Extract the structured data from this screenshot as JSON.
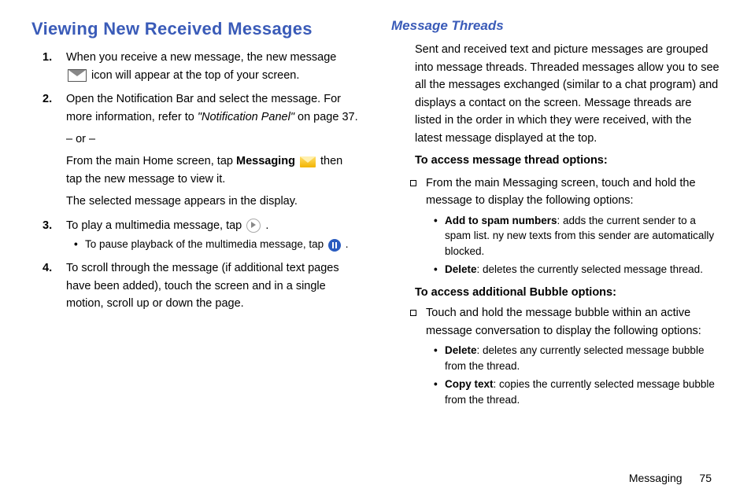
{
  "left": {
    "heading": "Viewing New Received Messages",
    "steps": {
      "s1_a": "When you receive a new message, the new message ",
      "s1_b": " icon will appear at the top of your screen.",
      "s2_a": "Open the Notification Bar and select the message. For more information, refer to ",
      "s2_ref": "\"Notification Panel\"",
      "s2_b": "  on page 37.",
      "s2_or": "– or –",
      "s2_c1": "From the main Home screen, tap ",
      "s2_msg": "Messaging",
      "s2_c2": " then tap the new message to view it.",
      "s2_d": "The selected message appears in the display.",
      "s3_a": "To play a multimedia message, tap ",
      "s3_b": " .",
      "s3_bullet_a": "To pause playback of the multimedia message, tap ",
      "s3_bullet_b": " .",
      "s4": "To scroll through the message (if additional text pages have been added), touch the screen and in a single motion, scroll up or down the page."
    }
  },
  "right": {
    "subheading": "Message Threads",
    "intro": "Sent and received text and picture messages are grouped into message threads. Threaded messages allow you to see all the messages exchanged (similar to a chat program) and displays a contact on the screen. Message threads are listed in the order in which they were received, with the latest message displayed at the top.",
    "h_thread": "To access message thread options:",
    "thread_item": "From the main Messaging screen, touch and hold the message to display the following options:",
    "thread_b1_bold": "Add to spam numbers",
    "thread_b1_rest": ": adds the current sender to a spam list. ny new texts from this sender are automatically blocked.",
    "thread_b2_bold": "Delete",
    "thread_b2_rest": ": deletes the currently selected message thread.",
    "h_bubble": "To access additional Bubble options:",
    "bubble_item": "Touch and hold the message bubble within an active message conversation to display the following options:",
    "bubble_b1_bold": "Delete",
    "bubble_b1_rest": ": deletes any currently selected message bubble from the thread.",
    "bubble_b2_bold": "Copy text",
    "bubble_b2_rest": ": copies the currently selected message bubble from the thread."
  },
  "footer": {
    "chapter": "Messaging",
    "page": "75"
  }
}
